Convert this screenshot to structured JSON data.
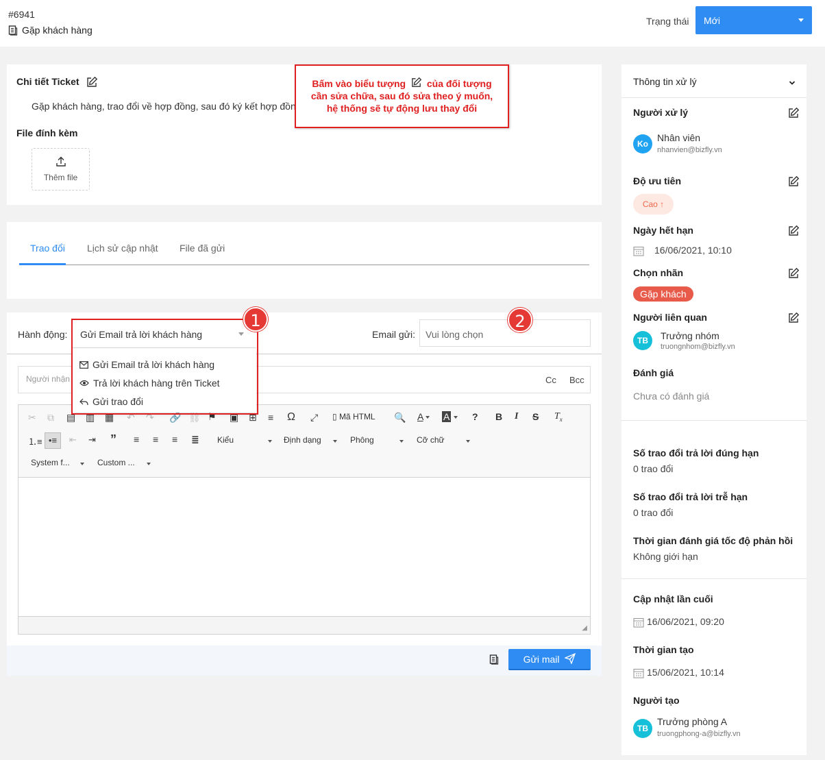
{
  "header": {
    "ticket_id": "#6941",
    "ticket_name": "Gặp khách hàng",
    "status_label": "Trạng thái",
    "status_value": "Mới"
  },
  "detail": {
    "title": "Chi tiết Ticket",
    "description": "Gặp khách hàng, trao đổi về hợp đồng, sau đó ký kết hợp đồng",
    "attachments_title": "File đính kèm",
    "upload_label": "Thêm file"
  },
  "callout": {
    "line1_before": "Bấm vào biểu tượng",
    "line1_after": "của đối tượng",
    "line2": "cần sửa chữa, sau đó sửa theo ý muốn,",
    "line3": "hệ thống sẽ tự động lưu thay đổi"
  },
  "tabs": [
    {
      "label": "Trao đổi",
      "active": true
    },
    {
      "label": "Lịch sử cập nhật",
      "active": false
    },
    {
      "label": "File đã gửi",
      "active": false
    }
  ],
  "compose": {
    "action_label": "Hành động:",
    "action_value": "Gửi Email trả lời khách hàng",
    "email_label": "Email gửi:",
    "email_placeholder": "Vui lòng chọn",
    "recipient_placeholder": "Người nhận",
    "cc": "Cc",
    "bcc": "Bcc",
    "options": [
      {
        "label": "Gửi Email trả lời khách hàng",
        "icon": "envelope-icon"
      },
      {
        "label": "Trả lời khách hàng trên Ticket",
        "icon": "eye-icon"
      },
      {
        "label": "Gửi trao đổi",
        "icon": "reply-icon"
      }
    ],
    "marker1": "1",
    "marker2": "2",
    "send_label": "Gửi mail"
  },
  "toolbar": {
    "html_label": "Mã HTML",
    "style_label": "Kiểu",
    "format_label": "Định dạng",
    "font_label": "Phông",
    "size_label": "Cỡ chữ",
    "system_font_label": "System f...",
    "custom_label": "Custom ..."
  },
  "side": {
    "section_title": "Thông tin xử lý",
    "assignee_title": "Người xử lý",
    "assignee": {
      "initials": "Ko",
      "name": "Nhân viên",
      "email": "nhanvien@bizfly.vn"
    },
    "priority_title": "Độ ưu tiên",
    "priority_value": "Cao",
    "due_title": "Ngày hết hạn",
    "due_value": "16/06/2021, 10:10",
    "label_title": "Chọn nhãn",
    "label_value": "Gặp khách",
    "related_title": "Người liên quan",
    "related": {
      "initials": "TB",
      "name": "Trưởng nhóm",
      "email": "truongnhom@bizfly.vn"
    },
    "rating_title": "Đánh giá",
    "rating_value": "Chưa có đánh giá",
    "ontime_title": "Số trao đổi trả lời đúng hạn",
    "ontime_value": "0 trao đổi",
    "late_title": "Số trao đổi trả lời trễ hạn",
    "late_value": "0 trao đổi",
    "response_title": "Thời gian đánh giá tốc độ phản hồi",
    "response_value": "Không giới hạn",
    "updated_title": "Cập nhật lần cuối",
    "updated_value": "16/06/2021, 09:20",
    "created_title": "Thời gian tạo",
    "created_value": "15/06/2021, 10:14",
    "creator_title": "Người tạo",
    "creator": {
      "initials": "TB",
      "name": "Trưởng phòng A",
      "email": "truongphong-a@bizfly.vn"
    }
  },
  "colors": {
    "accent": "#2f8cf2",
    "annotation": "#e02020",
    "priority_text": "#f0664a",
    "tag_bg": "#e85a4a"
  }
}
